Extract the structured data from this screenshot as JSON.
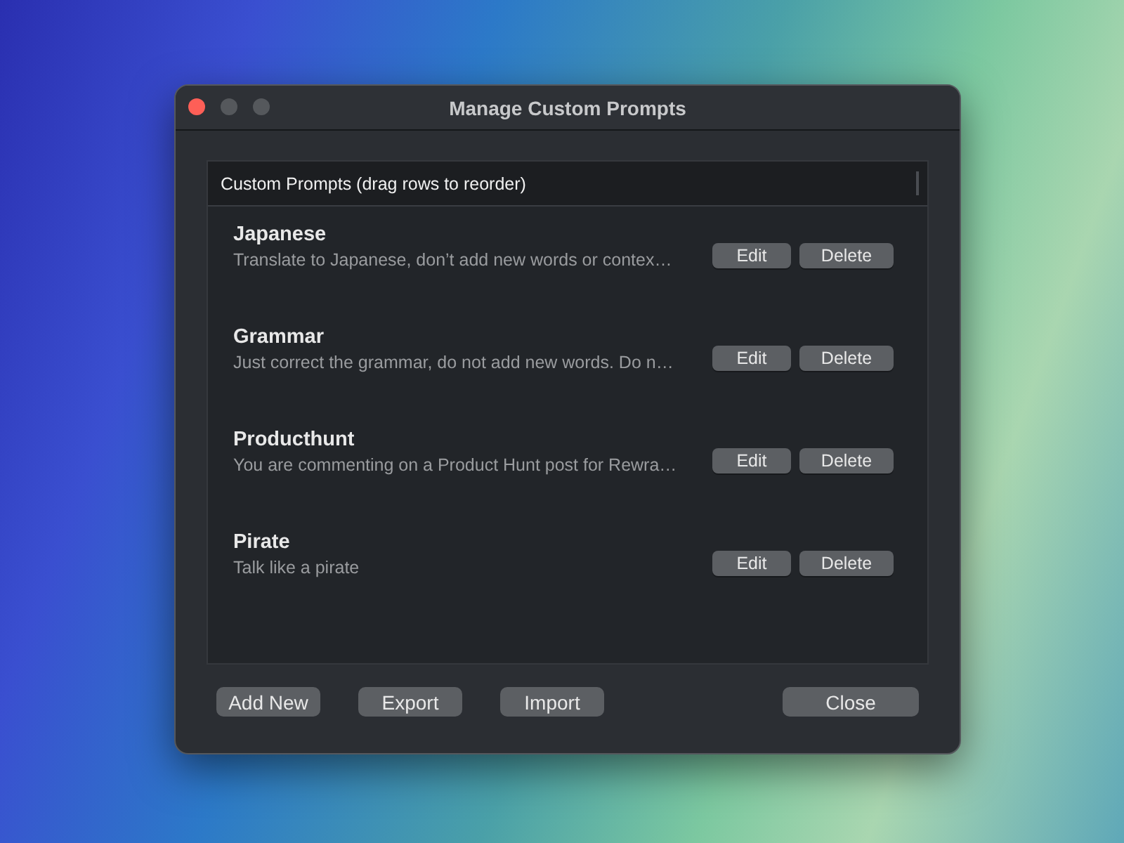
{
  "window": {
    "title": "Manage Custom Prompts"
  },
  "list": {
    "header": "Custom Prompts (drag rows to reorder)",
    "rows": [
      {
        "name": "Japanese",
        "description": "Translate to Japanese, don’t add new words or contex…",
        "actions": [
          "Edit",
          "Delete"
        ]
      },
      {
        "name": "Grammar",
        "description": "Just correct the grammar, do not add new words. Do n…",
        "actions": [
          "Edit",
          "Delete"
        ]
      },
      {
        "name": "Producthunt",
        "description": "You are commenting on a Product Hunt post for Rewra…",
        "actions": [
          "Edit",
          "Delete"
        ]
      },
      {
        "name": "Pirate",
        "description": "Talk like a pirate",
        "actions": [
          "Edit",
          "Delete"
        ]
      }
    ]
  },
  "buttons": [
    {
      "label": "Add New",
      "kind": "left"
    },
    {
      "label": "Export",
      "kind": "left"
    },
    {
      "label": "Import",
      "kind": "left"
    },
    {
      "label": "Close",
      "kind": "right"
    }
  ]
}
